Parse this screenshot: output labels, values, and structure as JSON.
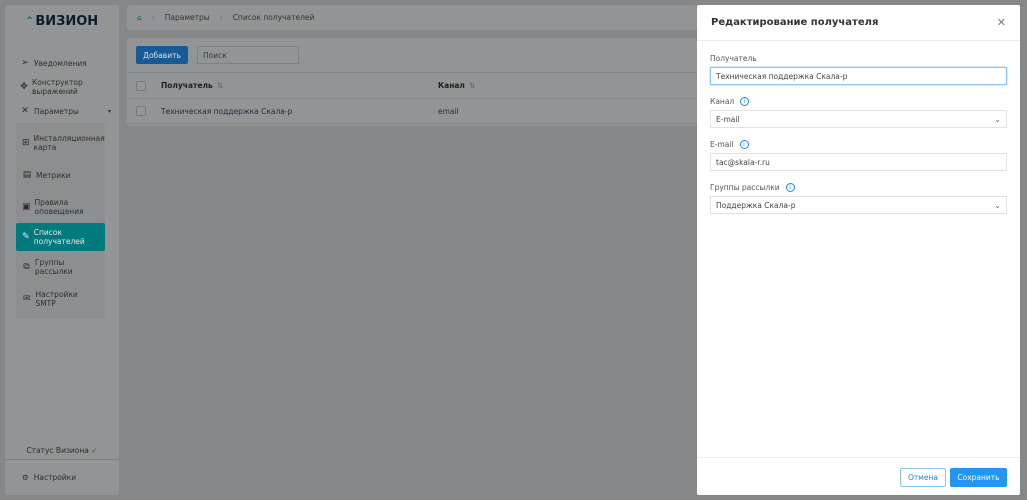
{
  "logo": "ВИЗИОН",
  "sidebar": {
    "items": [
      {
        "label": "Уведомления",
        "icon": "send-icon"
      },
      {
        "label": "Конструктор выражений",
        "icon": "constructor-icon"
      },
      {
        "label": "Параметры",
        "icon": "tools-icon"
      }
    ],
    "sub": [
      {
        "label": "Инсталляционная карта",
        "icon": "sitemap-icon"
      },
      {
        "label": "Метрики",
        "icon": "metrics-icon"
      },
      {
        "label": "Правила оповещения",
        "icon": "rules-icon"
      },
      {
        "label": "Список получателей",
        "icon": "recipients-icon"
      },
      {
        "label": "Группы рассылки",
        "icon": "groups-icon"
      },
      {
        "label": "Настройки SMTP",
        "icon": "smtp-icon"
      }
    ],
    "status": "Статус Визиона",
    "settings": "Настройки"
  },
  "breadcrumb": [
    "Параметры",
    "Список получателей"
  ],
  "toolbar": {
    "add": "Добавить",
    "search_placeholder": "Поиск"
  },
  "table": {
    "headers": [
      "Получатель",
      "Канал"
    ],
    "rows": [
      [
        "Техническая поддержка Скала-р",
        "email"
      ]
    ]
  },
  "drawer": {
    "title": "Редактирование получателя",
    "recipient_label": "Получатель",
    "recipient_value": "Техническая поддержка Скала-р",
    "channel_label": "Канал",
    "channel_value": "E-mail",
    "email_label": "E-mail",
    "email_value": "tac@skala-r.ru",
    "groups_label": "Группы рассылки",
    "groups_value": "Поддержка Скала-р",
    "cancel": "Отмена",
    "save": "Сохранить"
  }
}
